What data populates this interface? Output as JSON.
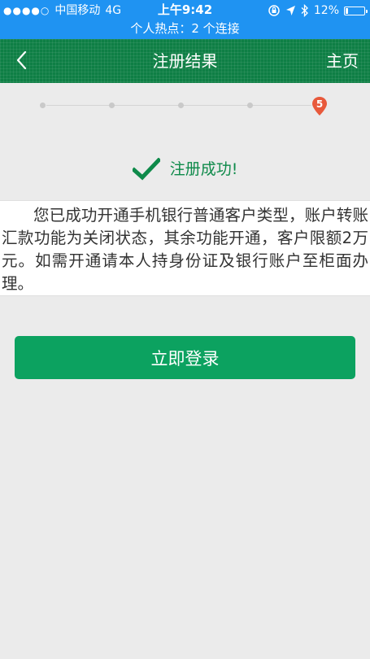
{
  "status_bar": {
    "signal_dots": "●●●●○",
    "carrier": "中国移动",
    "network": "4G",
    "time": "上午9:42",
    "battery": "12%",
    "battery_level": 0.12,
    "hotspot": "个人热点：2 个连接"
  },
  "nav": {
    "title": "注册结果",
    "home": "主页"
  },
  "progress": {
    "total_steps": 5,
    "current_step": 5,
    "current_label": "5",
    "accent": "#e8593b"
  },
  "result": {
    "success_text": "注册成功!",
    "message": "您已成功开通手机银行普通客户类型，账户转账汇款功能为关闭状态，其余功能开通，客户限额2万元。如需开通请本人持身份证及银行账户至柜面办理。"
  },
  "actions": {
    "login": "立即登录"
  },
  "colors": {
    "status_bar": "#1f93f2",
    "nav_bar": "#0e7f45",
    "button": "#0ca260",
    "success": "#0e8a4a"
  }
}
